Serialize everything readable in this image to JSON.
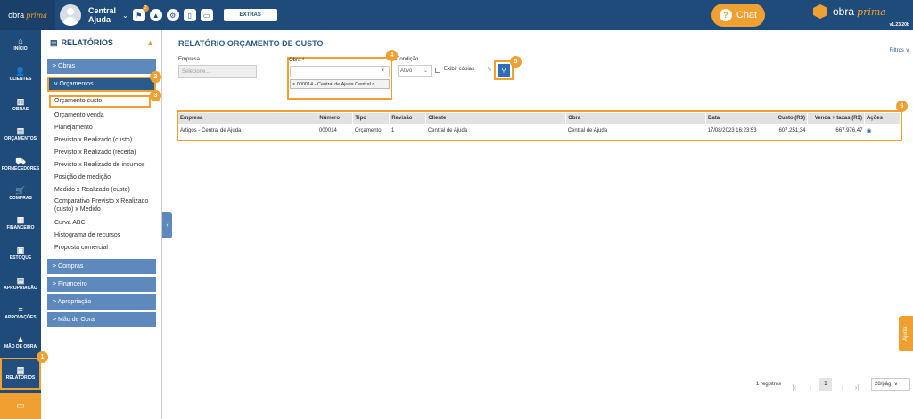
{
  "header": {
    "logo_text": "obra",
    "logo_italic": "prima",
    "user_line1": "Central",
    "user_line2": "Ajuda",
    "notif_count": "2",
    "extras_label": "EXTRAS",
    "chat_label": "Chat",
    "brand_text": "obra",
    "brand_italic": "prima",
    "version": "v1.23.20b"
  },
  "leftnav": {
    "items": [
      {
        "label": "INÍCIO",
        "icon": "⌂"
      },
      {
        "label": "CLIENTES",
        "icon": "👤"
      },
      {
        "label": "OBRAS",
        "icon": "▥"
      },
      {
        "label": "ORÇAMENTOS",
        "icon": "▤"
      },
      {
        "label": "FORNECEDORES",
        "icon": "⛟"
      },
      {
        "label": "COMPRAS",
        "icon": "🛒"
      },
      {
        "label": "FINANCEIRO",
        "icon": "▦"
      },
      {
        "label": "ESTOQUE",
        "icon": "▣"
      },
      {
        "label": "APROPRIAÇÃO",
        "icon": "▤"
      },
      {
        "label": "APROVAÇÕES",
        "icon": "≡"
      },
      {
        "label": "MÃO DE OBRA",
        "icon": "▲"
      },
      {
        "label": "RELATÓRIOS",
        "icon": "▤"
      }
    ]
  },
  "panel": {
    "title": "RELATÓRIOS",
    "sections": {
      "obras": "> Obras",
      "orcamentos": "v Orçamentos",
      "compras": "> Compras",
      "financeiro": "> Financeiro",
      "apropriacao": "> Apropriação",
      "mao_de_obra": "> Mão de Obra"
    },
    "orcamento_items": [
      "Orçamento custo",
      "Orçamento venda",
      "Planejamento",
      "Previsto x Realizado (custo)",
      "Previsto x Realizado (receita)",
      "Previsto x Realizado de insumos",
      "Posição de medição",
      "Medido x Realizado (custo)",
      "Comparativo Previsto x Realizado (custo) x Medido",
      "Curva ABC",
      "Histograma de recursos",
      "Proposta comercial"
    ]
  },
  "main": {
    "title": "RELATÓRIO ORÇAMENTO DE CUSTO",
    "filtros": "Filtros ∨",
    "empresa_label": "Empresa",
    "empresa_placeholder": "Selecione...",
    "obra_label": "Obra *",
    "obra_clear": "×",
    "obra_tag": "× 000014 - Central de Ajuda Central d",
    "condicao_label": "Condição",
    "condicao_value": "Ativo",
    "exibir_copias": "Exibir cópias",
    "table": {
      "headers": [
        "Empresa",
        "Número",
        "Tipo",
        "Revisão",
        "Cliente",
        "Obra",
        "Data",
        "Custo (R$)",
        "Venda + taxas (R$)",
        "Ações"
      ],
      "rows": [
        [
          "Artigos - Central de Ajuda",
          "000014",
          "Orçamento",
          "1",
          "Central de Ajuda",
          "Central de Ajuda",
          "17/08/2023 16:23:53",
          "607.251,34",
          "667.976,47"
        ]
      ]
    },
    "pager": {
      "count": "1 registros",
      "current": "1",
      "per_page": "28/pág. ∨"
    },
    "ajuda": "Ajuda"
  },
  "markers": [
    "1",
    "2",
    "3",
    "4",
    "5",
    "6"
  ]
}
